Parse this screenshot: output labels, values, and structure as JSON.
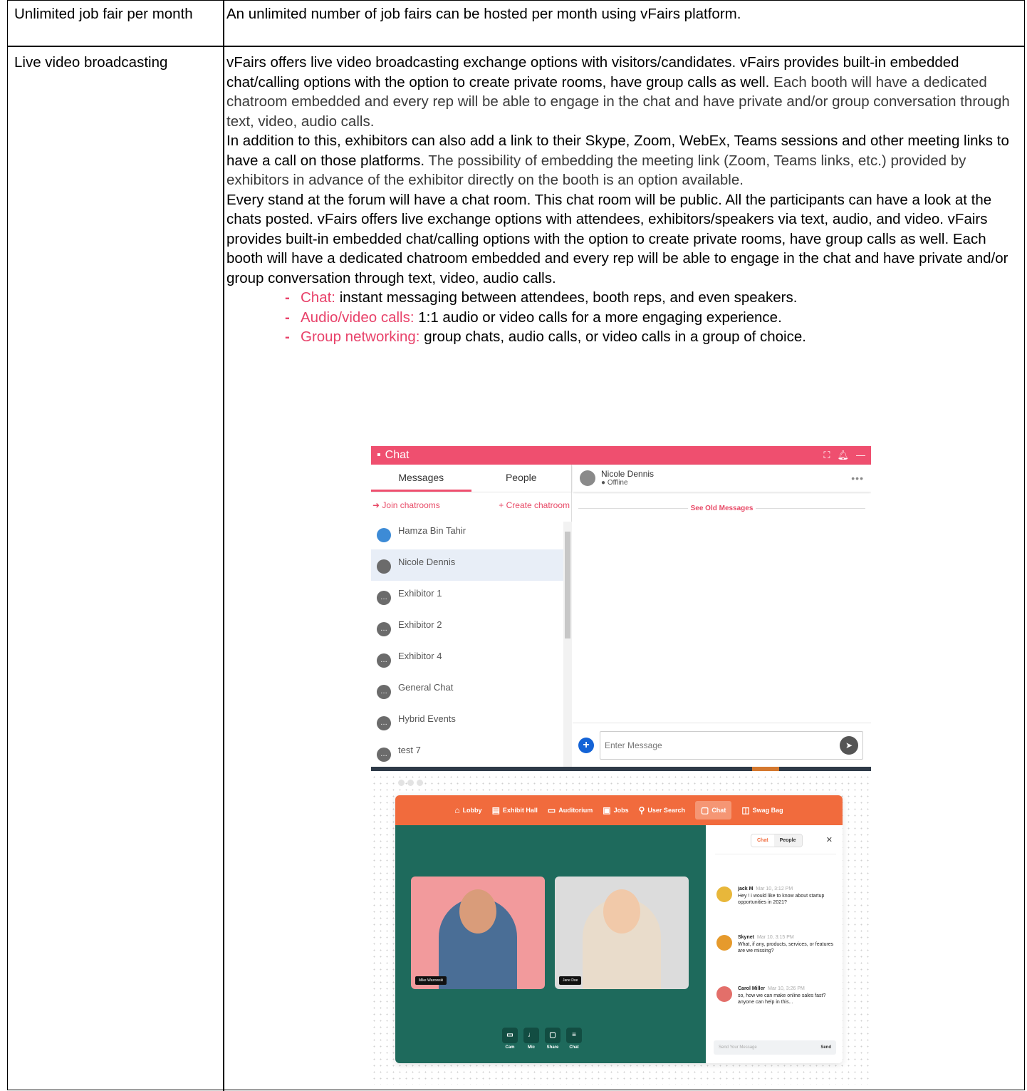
{
  "table": {
    "rows": [
      {
        "feature": "Unlimited job fair per month",
        "description": "An unlimited number of job fairs can be hosted per month using vFairs platform."
      },
      {
        "feature": "Live video broadcasting",
        "para1_a": "vFairs offers live video broadcasting exchange options with visitors/candidates. vFairs provides built-in embedded chat/calling options with the option to create private rooms, have group calls as well.",
        "para1_b": " Each booth will have a dedicated chatroom embedded and every rep will be able to engage in the chat and have private and/or group conversation through text, video, audio calls.",
        "para2_a": "In addition to this, exhibitors can also add a link to their Skype, Zoom, WebEx, Teams sessions and other meeting links to have a call on those platforms.",
        "para2_b": " The possibility of embedding the meeting link (Zoom, Teams links, etc.) provided by exhibitors in advance of the exhibitor directly on the booth is an option available.",
        "para3": "Every stand at the forum will have a chat room. This chat room will be public. All the participants can have a look at the chats posted. vFairs offers live exchange options with attendees, exhibitors/speakers via text, audio, and video. vFairs provides built-in embedded chat/calling options with the option to create private rooms, have group calls as well. Each booth will have a dedicated chatroom embedded and every rep will be able to engage in the chat and have private and/or group conversation through text, video, audio calls.",
        "bullets": [
          {
            "label": "Chat:",
            "text": " instant messaging between attendees, booth reps, and even speakers."
          },
          {
            "label": "Audio/video calls:",
            "text": " 1:1 audio or video calls for a more engaging experience."
          },
          {
            "label": "Group networking:",
            "text": " group chats, audio calls, or video calls in a group of choice."
          }
        ]
      }
    ]
  },
  "chat_widget": {
    "title": "Chat",
    "tabs": [
      "Messages",
      "People"
    ],
    "join_label": "Join chatrooms",
    "create_label": "Create chatroom",
    "contacts": [
      "Hamza Bin Tahir",
      "Nicole Dennis",
      "Exhibitor 1",
      "Exhibitor 2",
      "Exhibitor 4",
      "General Chat",
      "Hybrid Events",
      "test 7"
    ],
    "active_contact": {
      "name": "Nicole Dennis",
      "status": "Offline"
    },
    "see_old": "See Old Messages",
    "input_placeholder": "Enter Message"
  },
  "video_mock": {
    "nav": [
      "Lobby",
      "Exhibit Hall",
      "Auditorium",
      "Jobs",
      "User Search",
      "Chat",
      "Swag Bag"
    ],
    "participants": [
      "Mike Wazowski",
      "Jane Doe"
    ],
    "controls": [
      "Cam",
      "Mic",
      "Share",
      "Chat"
    ],
    "side_tabs": [
      "Chat",
      "People"
    ],
    "messages": [
      {
        "name": "jack M",
        "time": "Mar 10, 3:12 PM",
        "text": "Hey ! i would like to  know about startup opportunities in 2021?"
      },
      {
        "name": "Skynet",
        "time": "Mar 10, 3:15 PM",
        "text": "What, if any, products, services, or features are we missing?"
      },
      {
        "name": "Carol Miller",
        "time": "Mar 10, 3:26 PM",
        "text": "so, how we can make online sales fast? anyone can help in this..."
      }
    ],
    "input_placeholder": "Send Your Message",
    "send_label": "Send"
  },
  "colors": {
    "accent_pink": "#ef4f6f",
    "nav_orange": "#f16b3d",
    "stage_green": "#1e6a5c"
  }
}
